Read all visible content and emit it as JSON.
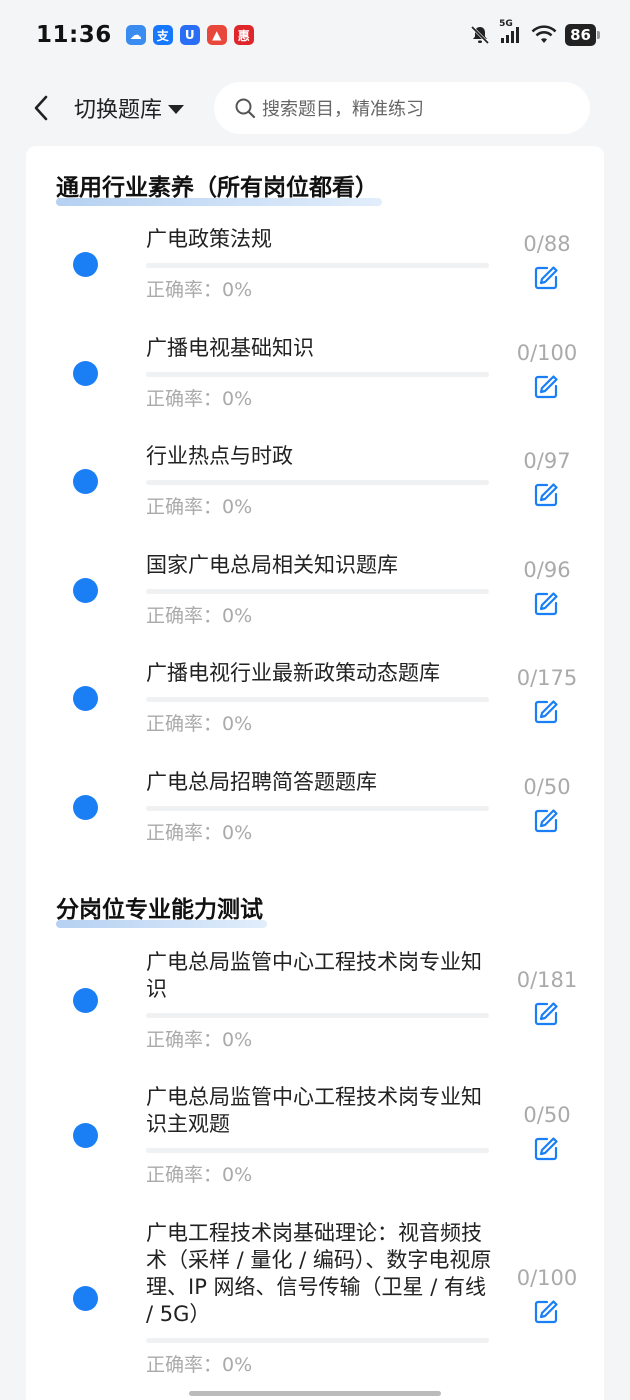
{
  "status_bar": {
    "time": "11:36",
    "network": "5G",
    "battery": "86",
    "app_icons": [
      {
        "name": "cloud-app-icon",
        "color": "#3b8cf0",
        "glyph": "☁"
      },
      {
        "name": "alipay-icon",
        "color": "#1677ff",
        "glyph": "支"
      },
      {
        "name": "shield-app-icon",
        "color": "#2a6ef5",
        "glyph": "U"
      },
      {
        "name": "triangle-app-icon",
        "color": "#e8473b",
        "glyph": "▲"
      },
      {
        "name": "red-app-icon",
        "color": "#e0252b",
        "glyph": "惠"
      }
    ]
  },
  "header": {
    "switch_label": "切换题库",
    "search_placeholder": "搜索题目，精准练习"
  },
  "colors": {
    "accent": "#1a7ff5",
    "muted_text": "#aaaaaa",
    "background": "#f4f5f7"
  },
  "sections": [
    {
      "title": "通用行业素养（所有岗位都看）",
      "items": [
        {
          "title": "广电政策法规",
          "accuracy": "正确率：0%",
          "count": "0/88",
          "progress": 0
        },
        {
          "title": "广播电视基础知识",
          "accuracy": "正确率：0%",
          "count": "0/100",
          "progress": 0
        },
        {
          "title": "行业热点与时政",
          "accuracy": "正确率：0%",
          "count": "0/97",
          "progress": 0
        },
        {
          "title": "国家广电总局相关知识题库",
          "accuracy": "正确率：0%",
          "count": "0/96",
          "progress": 0
        },
        {
          "title": "广播电视行业最新政策动态题库",
          "accuracy": "正确率：0%",
          "count": "0/175",
          "progress": 0
        },
        {
          "title": "广电总局招聘简答题题库",
          "accuracy": "正确率：0%",
          "count": "0/50",
          "progress": 0
        }
      ]
    },
    {
      "title": "分岗位专业能力测试",
      "items": [
        {
          "title": "广电总局监管中心工程技术岗专业知识",
          "accuracy": "正确率：0%",
          "count": "0/181",
          "progress": 0
        },
        {
          "title": "广电总局监管中心工程技术岗专业知识主观题",
          "accuracy": "正确率：0%",
          "count": "0/50",
          "progress": 0
        },
        {
          "title": "广电工程技术岗基础理论：视音频技术（采样 / 量化 / 编码）、数字电视原理、IP 网络、信号传输（卫星 / 有线 / 5G）",
          "accuracy": "正确率：0%",
          "count": "0/100",
          "progress": 0
        }
      ]
    }
  ]
}
